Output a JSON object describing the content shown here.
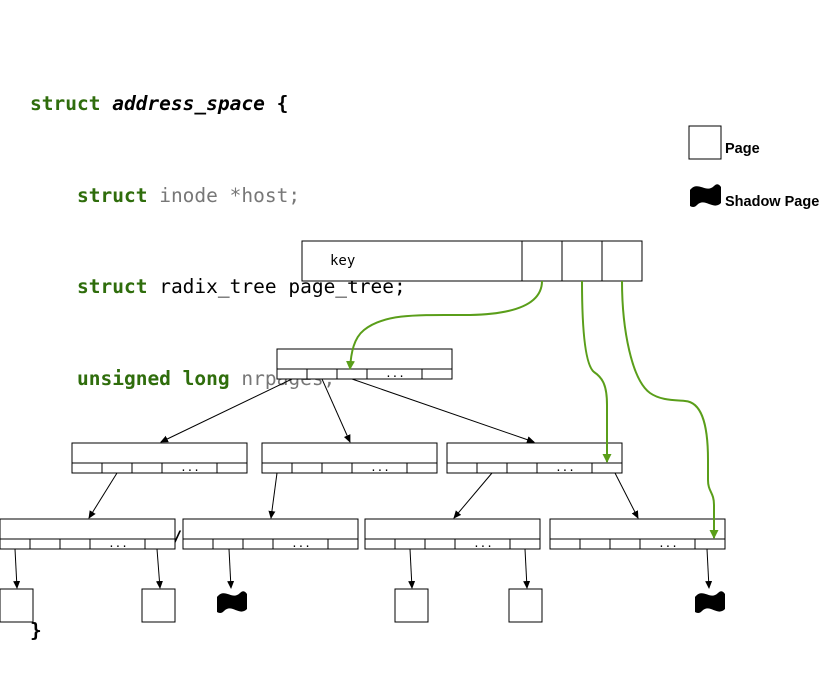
{
  "code": {
    "line1": {
      "kw": "struct",
      "name": "address_space",
      "brace": "{"
    },
    "line2": {
      "kw": "struct",
      "rest": "inode *host;"
    },
    "line3": {
      "kw": "struct",
      "rest": "radix_tree page_tree;"
    },
    "line4": {
      "kw": "unsigned long",
      "rest": "nrpages;"
    },
    "line5": {
      "comment": "/* ... */"
    },
    "line6": {
      "brace": "}"
    }
  },
  "root_key": "key",
  "ellipsis": "...",
  "legend": {
    "page_label": "Page",
    "shadow_label": "Shadow Page"
  },
  "colors": {
    "keyword": "#2f6d0c",
    "arrow_green": "#5a9e1a",
    "text_gray": "#777777"
  }
}
